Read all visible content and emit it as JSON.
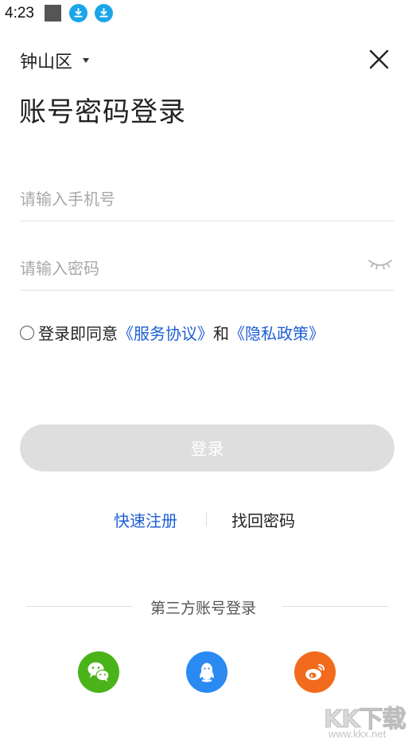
{
  "status_bar": {
    "time": "4:23"
  },
  "header": {
    "region": "钟山区",
    "title": "账号密码登录"
  },
  "form": {
    "phone_placeholder": "请输入手机号",
    "phone_value": "",
    "password_placeholder": "请输入密码",
    "password_value": ""
  },
  "agreement": {
    "prefix": "登录即同意",
    "service_link": "《服务协议》",
    "conjunction": "和",
    "privacy_link": "《隐私政策》",
    "checked": false
  },
  "actions": {
    "login_label": "登录",
    "quick_register": "快速注册",
    "find_password": "找回密码"
  },
  "third_party": {
    "label": "第三方账号登录",
    "providers": [
      {
        "name": "wechat-icon",
        "color": "#4bb31a"
      },
      {
        "name": "qq-icon",
        "color": "#2b8af2"
      },
      {
        "name": "weibo-icon",
        "color": "#f26a1b"
      }
    ]
  },
  "watermark": {
    "brand": "KK下载",
    "url": "www.kkx.net"
  },
  "colors": {
    "link": "#1d5fd6",
    "login_button_disabled": "#dedede",
    "download_badge": "#1aa5e8"
  }
}
